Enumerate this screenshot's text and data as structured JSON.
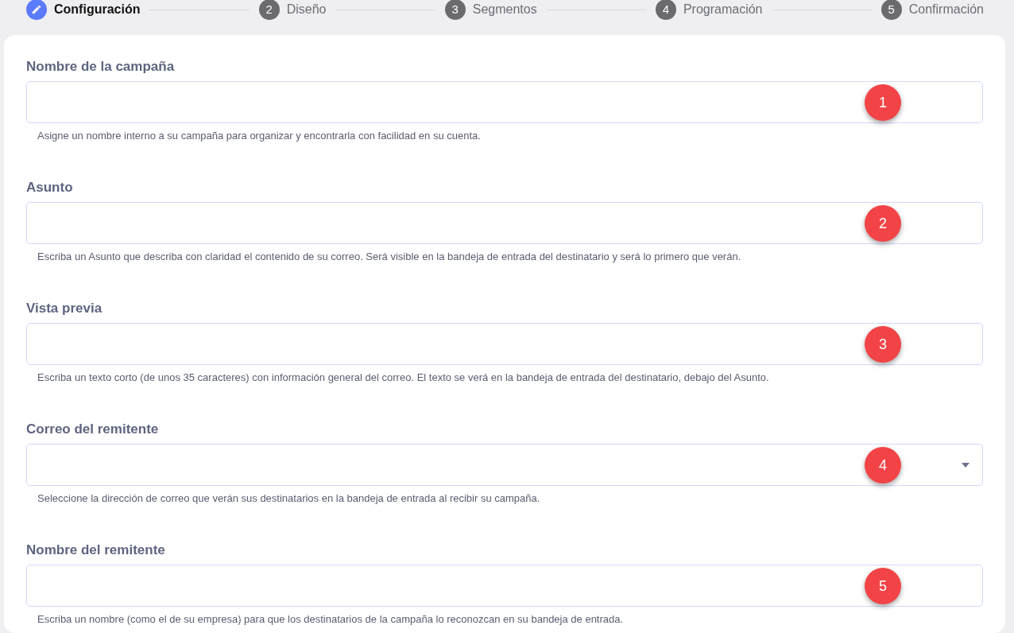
{
  "steps": [
    {
      "label": "Configuración",
      "selected": true
    },
    {
      "number": "2",
      "label": "Diseño",
      "selected": false
    },
    {
      "number": "3",
      "label": "Segmentos",
      "selected": false
    },
    {
      "number": "4",
      "label": "Programación",
      "selected": false
    },
    {
      "number": "5",
      "label": "Confirmación",
      "selected": false
    }
  ],
  "fields": [
    {
      "kind": "text",
      "label": "Nombre de la campaña",
      "help": "Asigne un nombre interno a su campaña para organizar y encontrarla con facilidad en su cuenta.",
      "marker": "1"
    },
    {
      "kind": "text",
      "label": "Asunto",
      "help": "Escriba un Asunto que describa con claridad el contenido de su correo. Será visible en la bandeja de entrada del destinatario y será lo primero que verán.",
      "marker": "2"
    },
    {
      "kind": "text",
      "label": "Vista previa",
      "help": "Escriba un texto corto (de unos 35 caracteres) con información general del correo. El texto se verá en la bandeja de entrada del destinatario, debajo del Asunto.",
      "marker": "3"
    },
    {
      "kind": "select",
      "label": "Correo del remitente",
      "help": "Seleccione la dirección de correo que verán sus destinatarios en la bandeja de entrada al recibir su campaña.",
      "marker": "4"
    },
    {
      "kind": "text",
      "label": "Nombre del remitente",
      "help": "Escriba un nombre (como el de su empresa) para que los destinatarios de la campaña lo reconozcan en su bandeja de entrada.",
      "marker": "5"
    }
  ]
}
